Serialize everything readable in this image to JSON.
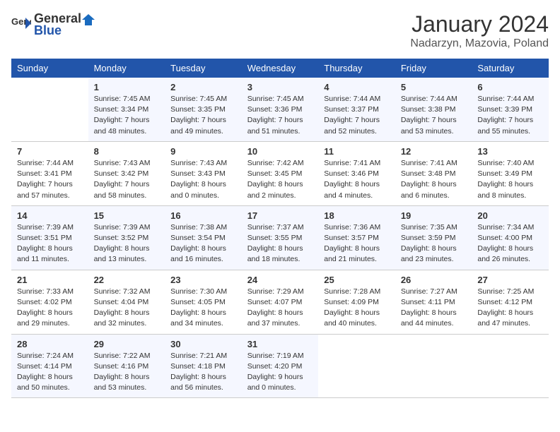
{
  "logo": {
    "general": "General",
    "blue": "Blue"
  },
  "title": "January 2024",
  "subtitle": "Nadarzyn, Mazovia, Poland",
  "weekdays": [
    "Sunday",
    "Monday",
    "Tuesday",
    "Wednesday",
    "Thursday",
    "Friday",
    "Saturday"
  ],
  "weeks": [
    [
      {
        "day": "",
        "info": ""
      },
      {
        "day": "1",
        "info": "Sunrise: 7:45 AM\nSunset: 3:34 PM\nDaylight: 7 hours\nand 48 minutes."
      },
      {
        "day": "2",
        "info": "Sunrise: 7:45 AM\nSunset: 3:35 PM\nDaylight: 7 hours\nand 49 minutes."
      },
      {
        "day": "3",
        "info": "Sunrise: 7:45 AM\nSunset: 3:36 PM\nDaylight: 7 hours\nand 51 minutes."
      },
      {
        "day": "4",
        "info": "Sunrise: 7:44 AM\nSunset: 3:37 PM\nDaylight: 7 hours\nand 52 minutes."
      },
      {
        "day": "5",
        "info": "Sunrise: 7:44 AM\nSunset: 3:38 PM\nDaylight: 7 hours\nand 53 minutes."
      },
      {
        "day": "6",
        "info": "Sunrise: 7:44 AM\nSunset: 3:39 PM\nDaylight: 7 hours\nand 55 minutes."
      }
    ],
    [
      {
        "day": "7",
        "info": "Sunrise: 7:44 AM\nSunset: 3:41 PM\nDaylight: 7 hours\nand 57 minutes."
      },
      {
        "day": "8",
        "info": "Sunrise: 7:43 AM\nSunset: 3:42 PM\nDaylight: 7 hours\nand 58 minutes."
      },
      {
        "day": "9",
        "info": "Sunrise: 7:43 AM\nSunset: 3:43 PM\nDaylight: 8 hours\nand 0 minutes."
      },
      {
        "day": "10",
        "info": "Sunrise: 7:42 AM\nSunset: 3:45 PM\nDaylight: 8 hours\nand 2 minutes."
      },
      {
        "day": "11",
        "info": "Sunrise: 7:41 AM\nSunset: 3:46 PM\nDaylight: 8 hours\nand 4 minutes."
      },
      {
        "day": "12",
        "info": "Sunrise: 7:41 AM\nSunset: 3:48 PM\nDaylight: 8 hours\nand 6 minutes."
      },
      {
        "day": "13",
        "info": "Sunrise: 7:40 AM\nSunset: 3:49 PM\nDaylight: 8 hours\nand 8 minutes."
      }
    ],
    [
      {
        "day": "14",
        "info": "Sunrise: 7:39 AM\nSunset: 3:51 PM\nDaylight: 8 hours\nand 11 minutes."
      },
      {
        "day": "15",
        "info": "Sunrise: 7:39 AM\nSunset: 3:52 PM\nDaylight: 8 hours\nand 13 minutes."
      },
      {
        "day": "16",
        "info": "Sunrise: 7:38 AM\nSunset: 3:54 PM\nDaylight: 8 hours\nand 16 minutes."
      },
      {
        "day": "17",
        "info": "Sunrise: 7:37 AM\nSunset: 3:55 PM\nDaylight: 8 hours\nand 18 minutes."
      },
      {
        "day": "18",
        "info": "Sunrise: 7:36 AM\nSunset: 3:57 PM\nDaylight: 8 hours\nand 21 minutes."
      },
      {
        "day": "19",
        "info": "Sunrise: 7:35 AM\nSunset: 3:59 PM\nDaylight: 8 hours\nand 23 minutes."
      },
      {
        "day": "20",
        "info": "Sunrise: 7:34 AM\nSunset: 4:00 PM\nDaylight: 8 hours\nand 26 minutes."
      }
    ],
    [
      {
        "day": "21",
        "info": "Sunrise: 7:33 AM\nSunset: 4:02 PM\nDaylight: 8 hours\nand 29 minutes."
      },
      {
        "day": "22",
        "info": "Sunrise: 7:32 AM\nSunset: 4:04 PM\nDaylight: 8 hours\nand 32 minutes."
      },
      {
        "day": "23",
        "info": "Sunrise: 7:30 AM\nSunset: 4:05 PM\nDaylight: 8 hours\nand 34 minutes."
      },
      {
        "day": "24",
        "info": "Sunrise: 7:29 AM\nSunset: 4:07 PM\nDaylight: 8 hours\nand 37 minutes."
      },
      {
        "day": "25",
        "info": "Sunrise: 7:28 AM\nSunset: 4:09 PM\nDaylight: 8 hours\nand 40 minutes."
      },
      {
        "day": "26",
        "info": "Sunrise: 7:27 AM\nSunset: 4:11 PM\nDaylight: 8 hours\nand 44 minutes."
      },
      {
        "day": "27",
        "info": "Sunrise: 7:25 AM\nSunset: 4:12 PM\nDaylight: 8 hours\nand 47 minutes."
      }
    ],
    [
      {
        "day": "28",
        "info": "Sunrise: 7:24 AM\nSunset: 4:14 PM\nDaylight: 8 hours\nand 50 minutes."
      },
      {
        "day": "29",
        "info": "Sunrise: 7:22 AM\nSunset: 4:16 PM\nDaylight: 8 hours\nand 53 minutes."
      },
      {
        "day": "30",
        "info": "Sunrise: 7:21 AM\nSunset: 4:18 PM\nDaylight: 8 hours\nand 56 minutes."
      },
      {
        "day": "31",
        "info": "Sunrise: 7:19 AM\nSunset: 4:20 PM\nDaylight: 9 hours\nand 0 minutes."
      },
      {
        "day": "",
        "info": ""
      },
      {
        "day": "",
        "info": ""
      },
      {
        "day": "",
        "info": ""
      }
    ]
  ]
}
